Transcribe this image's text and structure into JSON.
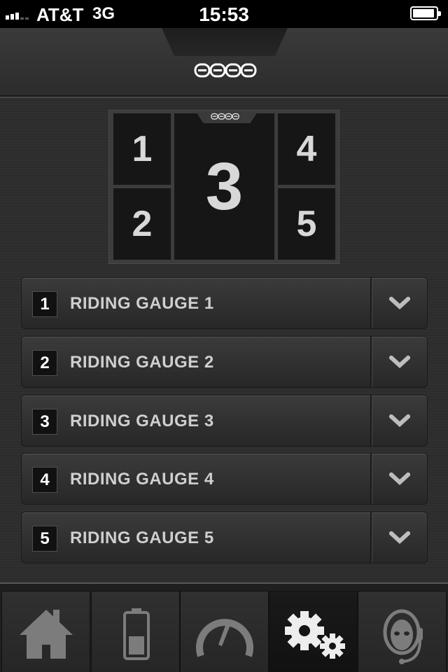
{
  "status_bar": {
    "carrier": "AT&T",
    "network": "3G",
    "time": "15:53"
  },
  "header": {
    "logo_text": "ZERO",
    "logo_icon": "zero-logo"
  },
  "layout_preview": {
    "slots": [
      "1",
      "2",
      "3",
      "4",
      "5"
    ]
  },
  "gauges": [
    {
      "number": "1",
      "label": "RIDING GAUGE 1",
      "icon": "chevron-down-icon"
    },
    {
      "number": "2",
      "label": "RIDING GAUGE 2",
      "icon": "chevron-down-icon"
    },
    {
      "number": "3",
      "label": "RIDING GAUGE 3",
      "icon": "chevron-down-icon"
    },
    {
      "number": "4",
      "label": "RIDING GAUGE 4",
      "icon": "chevron-down-icon"
    },
    {
      "number": "5",
      "label": "RIDING GAUGE 5",
      "icon": "chevron-down-icon"
    }
  ],
  "tabbar": {
    "tabs": [
      {
        "icon": "home-icon",
        "active": false
      },
      {
        "icon": "battery-icon",
        "active": false
      },
      {
        "icon": "speedometer-icon",
        "active": false
      },
      {
        "icon": "gears-icon",
        "active": true
      },
      {
        "icon": "support-headset-icon",
        "active": false
      }
    ]
  },
  "colors": {
    "background": "#2e2e2e",
    "text": "#cfcfcf",
    "active_tab": "#141414"
  }
}
